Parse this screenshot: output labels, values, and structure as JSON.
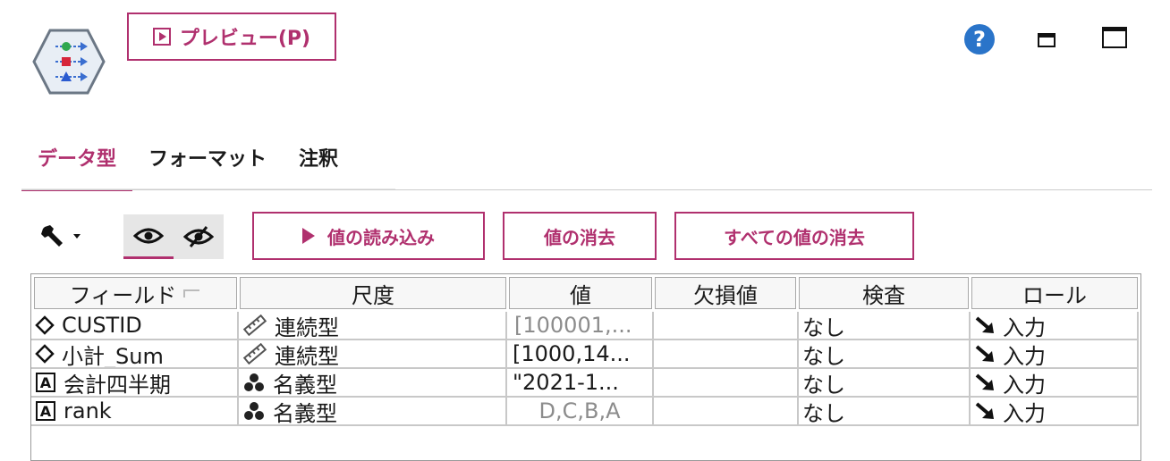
{
  "header": {
    "preview_label": "プレビュー(P)",
    "help_symbol": "?"
  },
  "tabs": [
    {
      "label": "データ型",
      "active": true
    },
    {
      "label": "フォーマット",
      "active": false
    },
    {
      "label": "注釈",
      "active": false
    }
  ],
  "toolbar": {
    "read_values": "値の読み込み",
    "clear_values": "値の消去",
    "clear_all_values": "すべての値の消去"
  },
  "table": {
    "columns": [
      "フィールド",
      "尺度",
      "値",
      "欠損値",
      "検査",
      "ロール"
    ],
    "rows": [
      {
        "field": "CUSTID",
        "field_icon": "continuous-field-icon",
        "measure": "連続型",
        "measure_icon": "ruler-icon",
        "values": "[100001,...",
        "values_muted": true,
        "missing": "",
        "check": "なし",
        "role": "入力"
      },
      {
        "field": "小計_Sum",
        "field_icon": "continuous-field-icon",
        "measure": "連続型",
        "measure_icon": "ruler-icon",
        "values": "[1000,14...",
        "values_muted": false,
        "missing": "",
        "check": "なし",
        "role": "入力"
      },
      {
        "field": "会計四半期",
        "field_icon": "string-field-icon",
        "measure": "名義型",
        "measure_icon": "nominal-icon",
        "values": "\"2021-1...",
        "values_muted": false,
        "missing": "",
        "check": "なし",
        "role": "入力"
      },
      {
        "field": "rank",
        "field_icon": "string-field-icon",
        "measure": "名義型",
        "measure_icon": "nominal-icon",
        "values": "D,C,B,A",
        "values_muted": true,
        "missing": "",
        "check": "なし",
        "role": "入力"
      }
    ]
  },
  "colors": {
    "accent": "#b0306e",
    "help": "#2a74c9"
  }
}
